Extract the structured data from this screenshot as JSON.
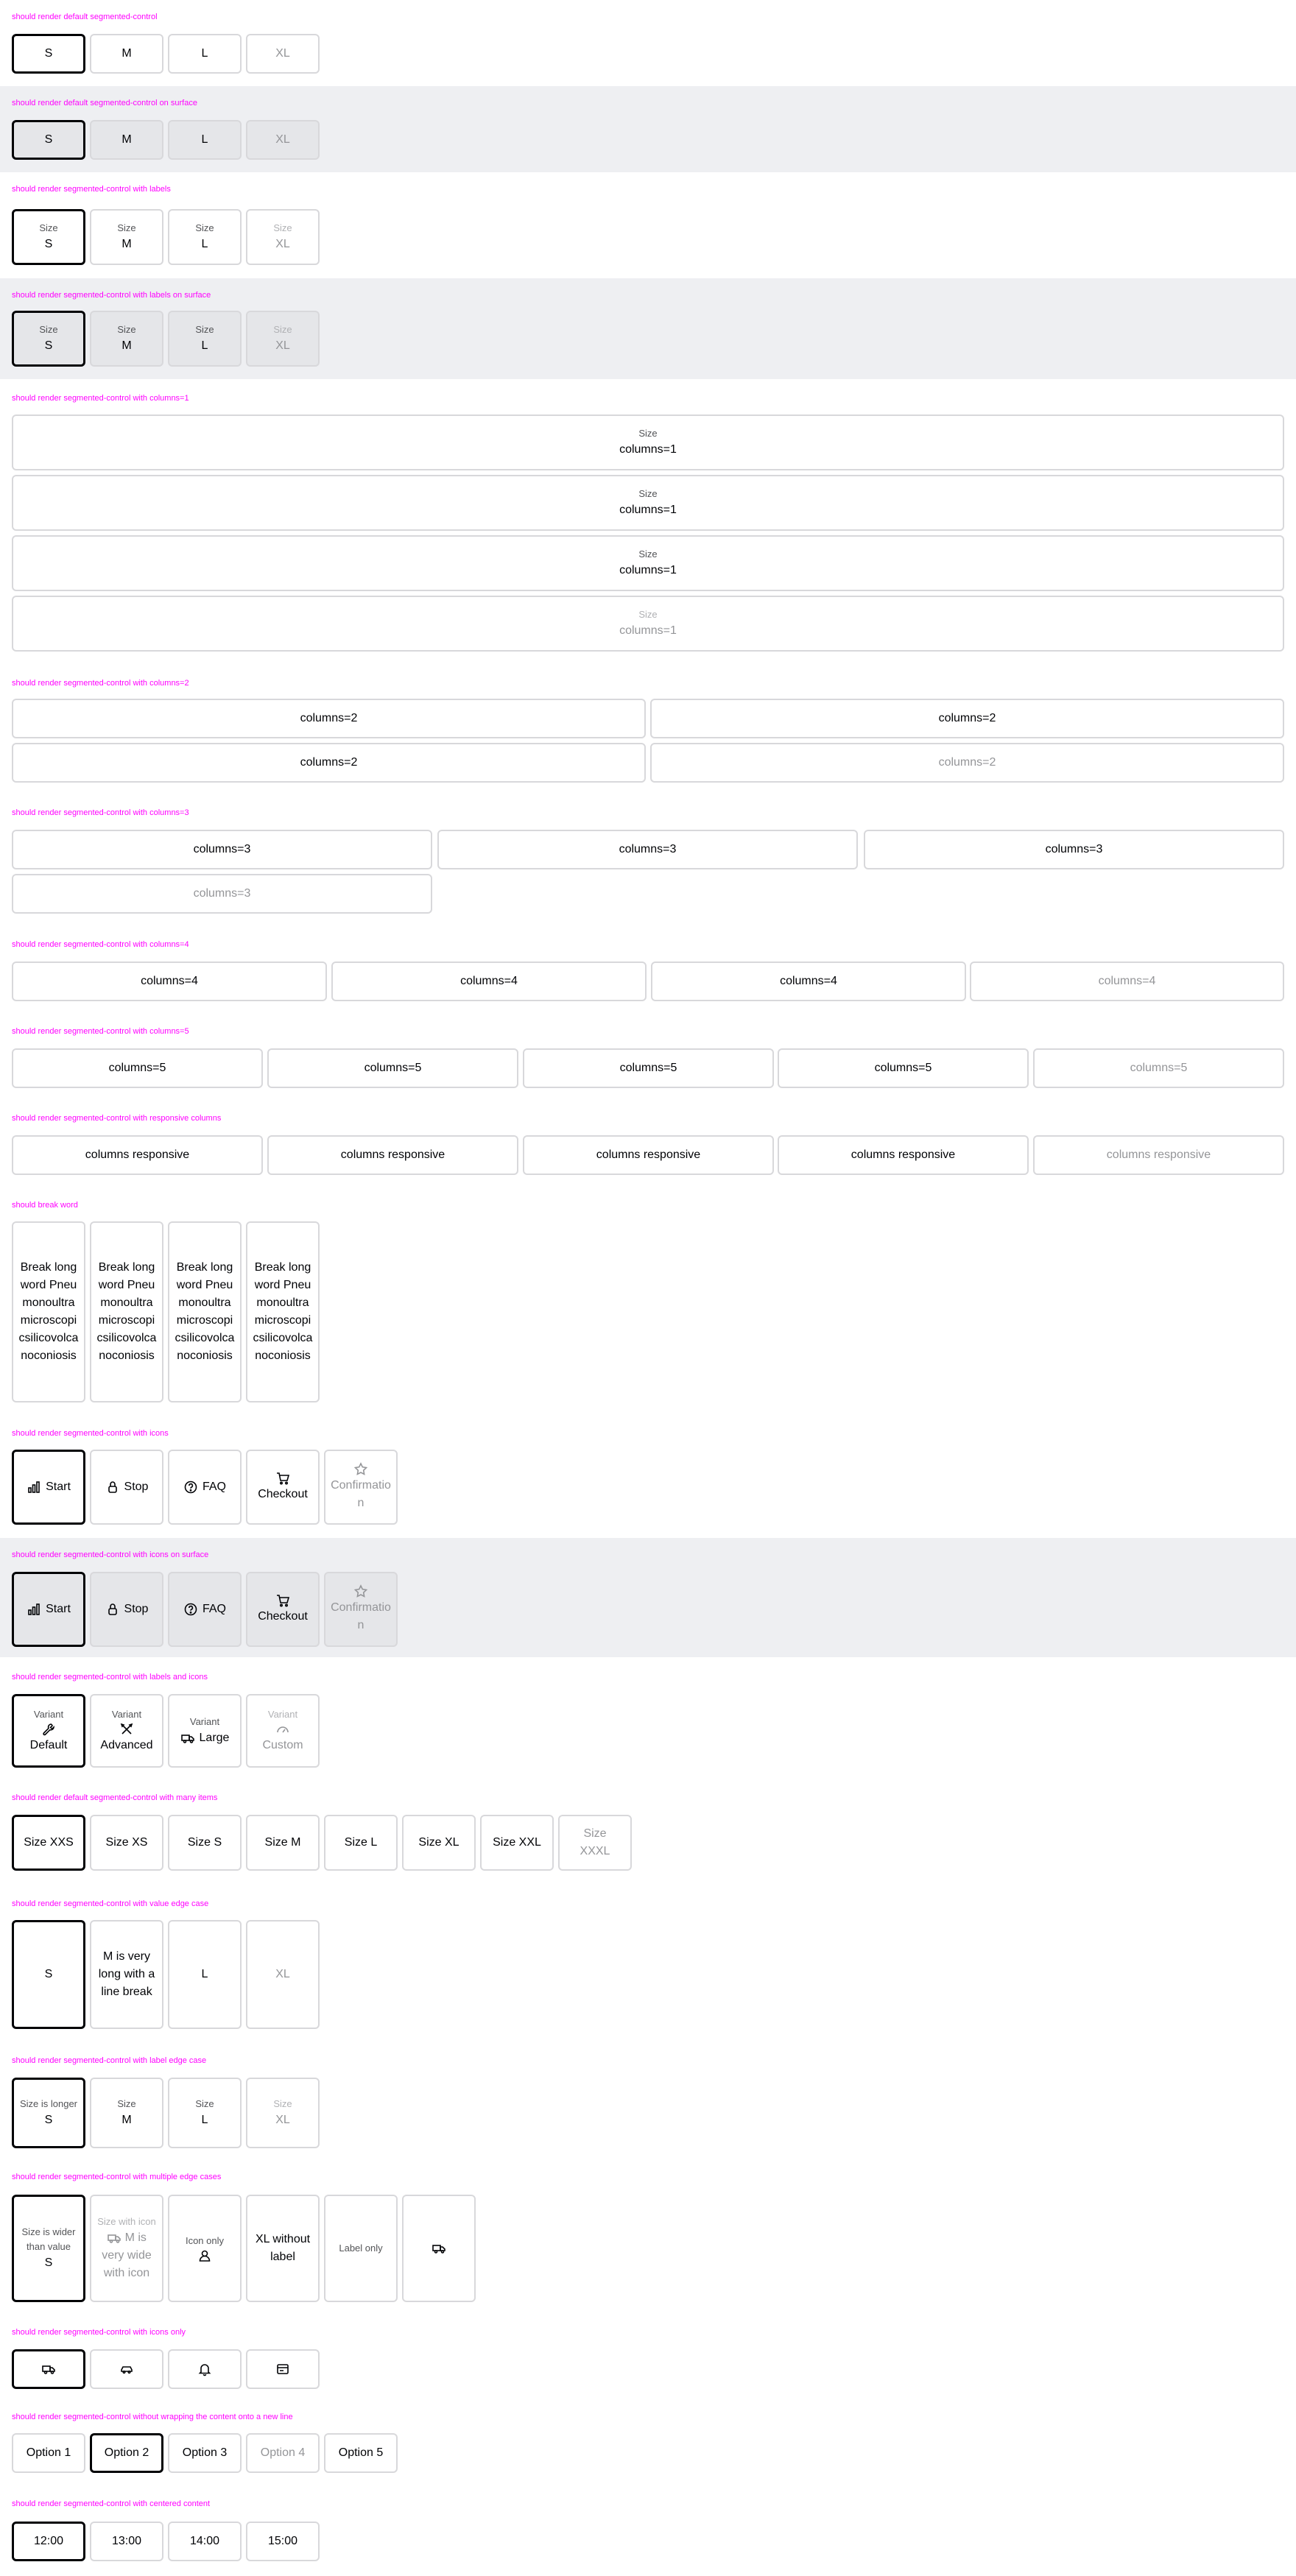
{
  "headings": {
    "s1": "should render default segmented-control",
    "s2": "should render default segmented-control on surface",
    "s3": "should render segmented-control with labels",
    "s4": "should render segmented-control with labels on surface",
    "s5": "should render segmented-control with columns=1",
    "s6": "should render segmented-control with columns=2",
    "s7": "should render segmented-control with columns=3",
    "s8": "should render segmented-control with columns=4",
    "s9": "should render segmented-control with columns=5",
    "s10": "should render segmented-control with responsive columns",
    "s11": "should break word",
    "s12": "should render segmented-control with icons",
    "s13": "should render segmented-control with icons on surface",
    "s14": "should render segmented-control with labels and icons",
    "s15": "should render default segmented-control with many items",
    "s16": "should render segmented-control with value edge case",
    "s17": "should render segmented-control with label edge case",
    "s18": "should render segmented-control with multiple edge cases",
    "s19": "should render segmented-control with icons only",
    "s20": "should render segmented-control without wrapping the content onto a new line",
    "s21": "should render segmented-control with centered content"
  },
  "sizes": [
    "S",
    "M",
    "L",
    "XL"
  ],
  "label_size": "Size",
  "cols": {
    "c1": "columns=1",
    "c2": "columns=2",
    "c3": "columns=3",
    "c4": "columns=4",
    "c5": "columns=5",
    "resp": "columns responsive"
  },
  "break_word": "Break long word Pneumonoultramicroscopicsilicovolcanoconiosis",
  "icons_items": [
    "Start",
    "Stop",
    "FAQ",
    "Checkout",
    "Confirmation"
  ],
  "variant": {
    "label": "Variant",
    "values": [
      "Default",
      "Advanced",
      "Large",
      "Custom"
    ]
  },
  "many": [
    "Size XXS",
    "Size XS",
    "Size S",
    "Size M",
    "Size L",
    "Size XL",
    "Size XXL",
    "Size XXXL"
  ],
  "value_edge": [
    "S",
    "M is very long with a line break",
    "L",
    "XL"
  ],
  "label_edge": {
    "first_label": "Size is longer"
  },
  "multi_edge": {
    "a_label": "Size is wider than value",
    "a_value": "S",
    "b_label": "Size with icon",
    "b_value": "M is very wide with icon",
    "c_label": "Icon only",
    "d_value": "XL without label",
    "e_label": "Label only"
  },
  "options": [
    "Option 1",
    "Option 2",
    "Option 3",
    "Option 4",
    "Option 5"
  ],
  "times": [
    "12:00",
    "13:00",
    "14:00",
    "15:00"
  ],
  "colors": {
    "heading": "#ff00ff",
    "surface": "#EEEFF2",
    "border": "#D8D8DB",
    "selected": "#010205",
    "disabled": "#949598"
  }
}
